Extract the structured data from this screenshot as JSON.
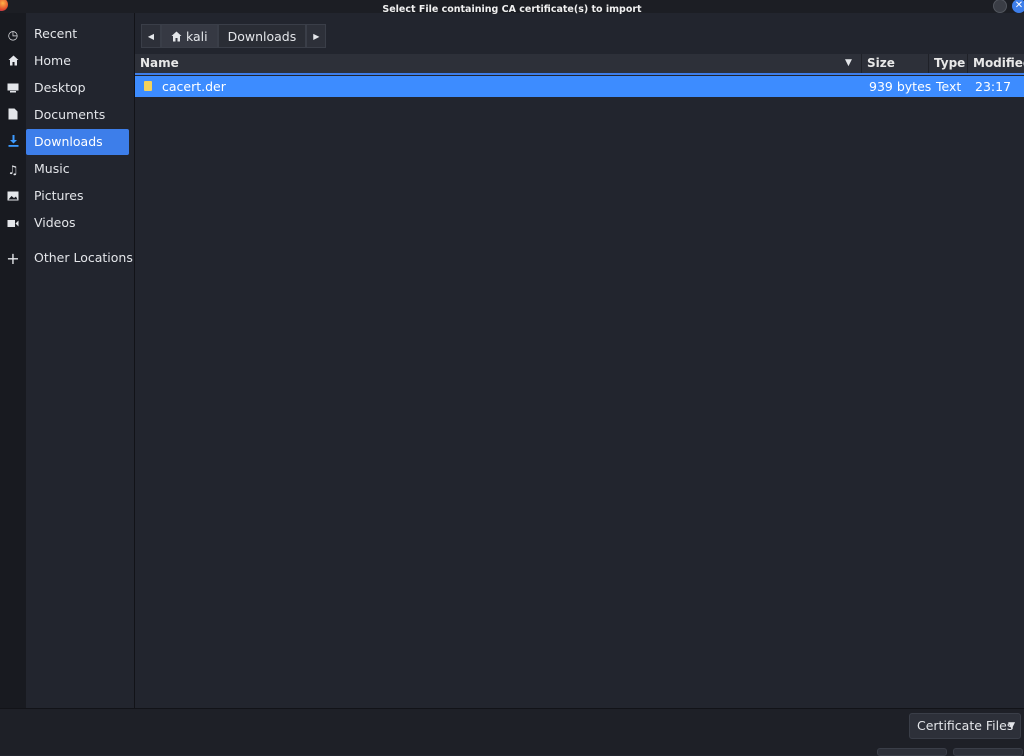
{
  "window": {
    "title": "Select File containing CA certificate(s) to import",
    "accent_color": "#3d7eea",
    "selection_color": "#3d8cff"
  },
  "sidebar": {
    "items": [
      {
        "label": "Recent",
        "icon": "clock-icon"
      },
      {
        "label": "Home",
        "icon": "home-icon"
      },
      {
        "label": "Desktop",
        "icon": "desktop-icon"
      },
      {
        "label": "Documents",
        "icon": "document-icon"
      },
      {
        "label": "Downloads",
        "icon": "download-icon",
        "active": true
      },
      {
        "label": "Music",
        "icon": "music-icon"
      },
      {
        "label": "Pictures",
        "icon": "picture-icon"
      },
      {
        "label": "Videos",
        "icon": "video-icon"
      },
      {
        "label": "Other Locations",
        "icon": "plus-icon"
      }
    ]
  },
  "pathbar": {
    "home_label": "kali",
    "current_label": "Downloads"
  },
  "file_list": {
    "columns": [
      "Name",
      "Size",
      "Type",
      "Modified"
    ],
    "rows": [
      {
        "name": "cacert.der",
        "size": "939 bytes",
        "type": "Text",
        "modified": "23:17",
        "icon": "text-file-icon"
      }
    ]
  },
  "footer": {
    "filter_label": "Certificate Files"
  }
}
